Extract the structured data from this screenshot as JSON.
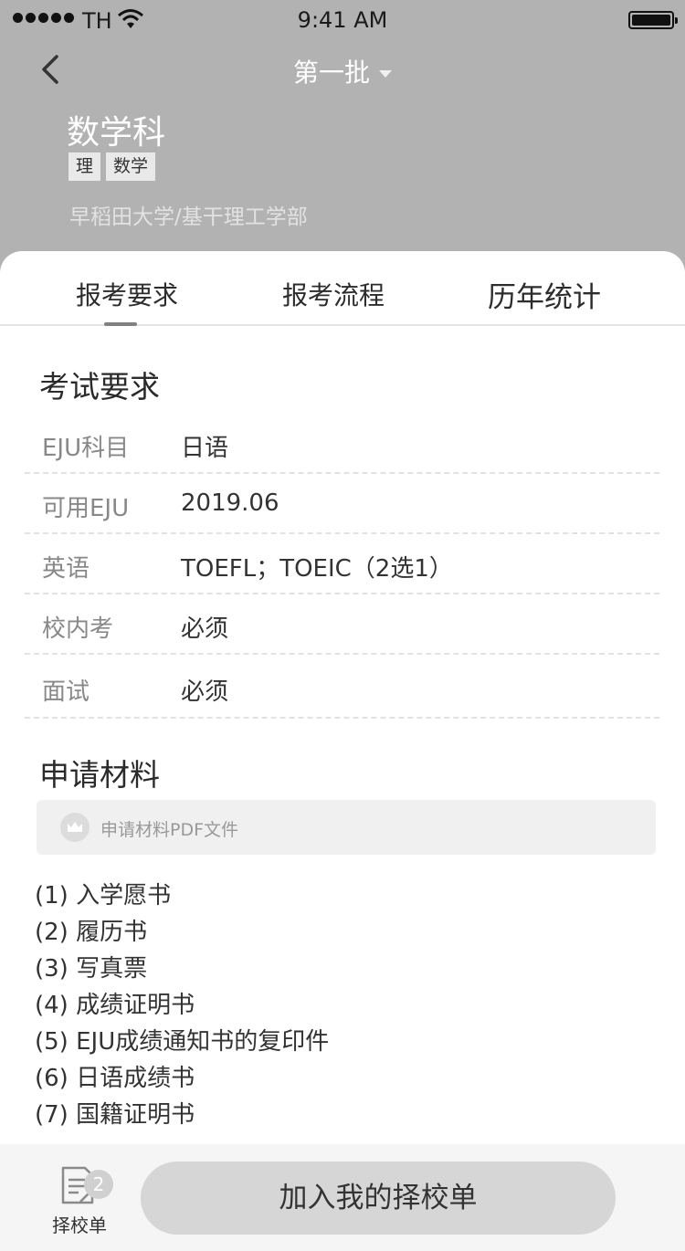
{
  "status_bar": {
    "carrier": "TH",
    "time": "9:41 AM"
  },
  "nav": {
    "title": "第一批"
  },
  "header": {
    "major": "数学科",
    "tags": [
      "理",
      "数学"
    ],
    "school": "早稻田大学/基干理工学部"
  },
  "tabs": [
    {
      "label": "报考要求",
      "active": true
    },
    {
      "label": "报考流程",
      "active": false
    },
    {
      "label": "历年统计",
      "active": false
    }
  ],
  "exam_requirements": {
    "title": "考试要求",
    "rows": [
      {
        "label": "EJU科目",
        "value": "日语"
      },
      {
        "label": "可用EJU",
        "value": "2019.06"
      },
      {
        "label": "英语",
        "value": "TOEFL；TOEIC（2选1）"
      },
      {
        "label": "校内考",
        "value": "必须"
      },
      {
        "label": "面试",
        "value": "必须"
      }
    ]
  },
  "materials": {
    "title": "申请材料",
    "pdf_label": "申请材料PDF文件",
    "items": [
      "(1) 入学愿书",
      "(2) 履历书",
      "(3) 写真票",
      "(4) 成绩证明书",
      "(5) EJU成绩通知书的复印件",
      "(6) 日语成绩书",
      "(7) 国籍证明书"
    ]
  },
  "bottom_bar": {
    "cart_label": "择校单",
    "cart_count": "2",
    "cta_label": "加入我的择校单"
  },
  "colors": {
    "header_bg": "#b2b2b2",
    "sheet_bg": "#ffffff",
    "cta_bg": "#d6d6d6"
  }
}
